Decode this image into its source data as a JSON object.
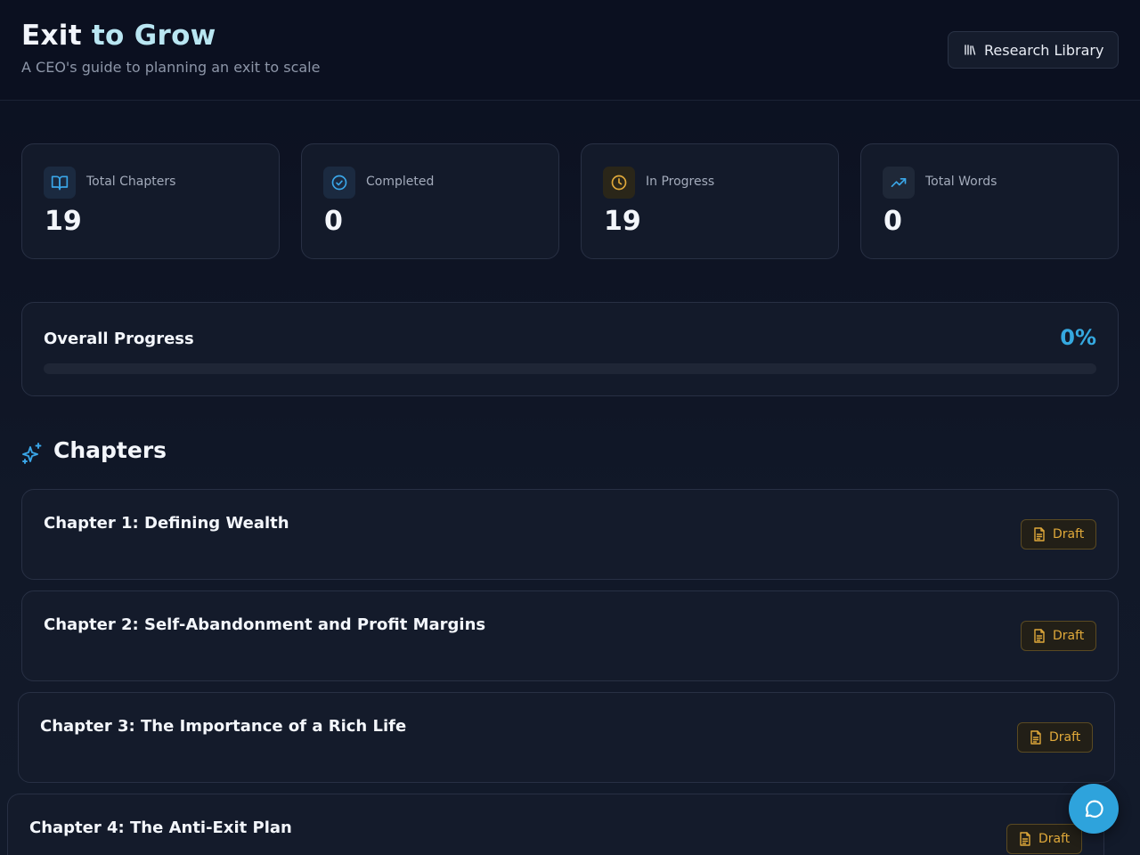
{
  "header": {
    "title_part1": "Exit",
    "title_part2": "to Grow",
    "subtitle": "A CEO's guide to planning an exit to scale",
    "research_button_label": "Research Library"
  },
  "stats": [
    {
      "label": "Total Chapters",
      "value": "19",
      "icon": "book-open-icon",
      "color": "#3aa6e8"
    },
    {
      "label": "Completed",
      "value": "0",
      "icon": "check-circle-icon",
      "color": "#3aa6e8"
    },
    {
      "label": "In Progress",
      "value": "19",
      "icon": "clock-icon",
      "color": "#e0a93a"
    },
    {
      "label": "Total Words",
      "value": "0",
      "icon": "trending-up-icon",
      "color": "#3aa6e8"
    }
  ],
  "progress": {
    "title": "Overall Progress",
    "percent_label": "0%",
    "fraction": 0
  },
  "chapters_section": {
    "title": "Chapters",
    "icon": "sparkles-icon"
  },
  "chapters": [
    {
      "title": "Chapter 1: Defining Wealth",
      "status": "Draft"
    },
    {
      "title": "Chapter 2: Self-Abandonment and Profit Margins",
      "status": "Draft"
    },
    {
      "title": "Chapter 3: The Importance of a Rich Life",
      "status": "Draft"
    },
    {
      "title": "Chapter 4: The Anti-Exit Plan",
      "status": "Draft"
    }
  ],
  "colors": {
    "accent": "#35a9e0",
    "draft": "#e0a93a",
    "background": "#0d1220"
  },
  "chat_button": {
    "icon": "message-circle-icon"
  }
}
